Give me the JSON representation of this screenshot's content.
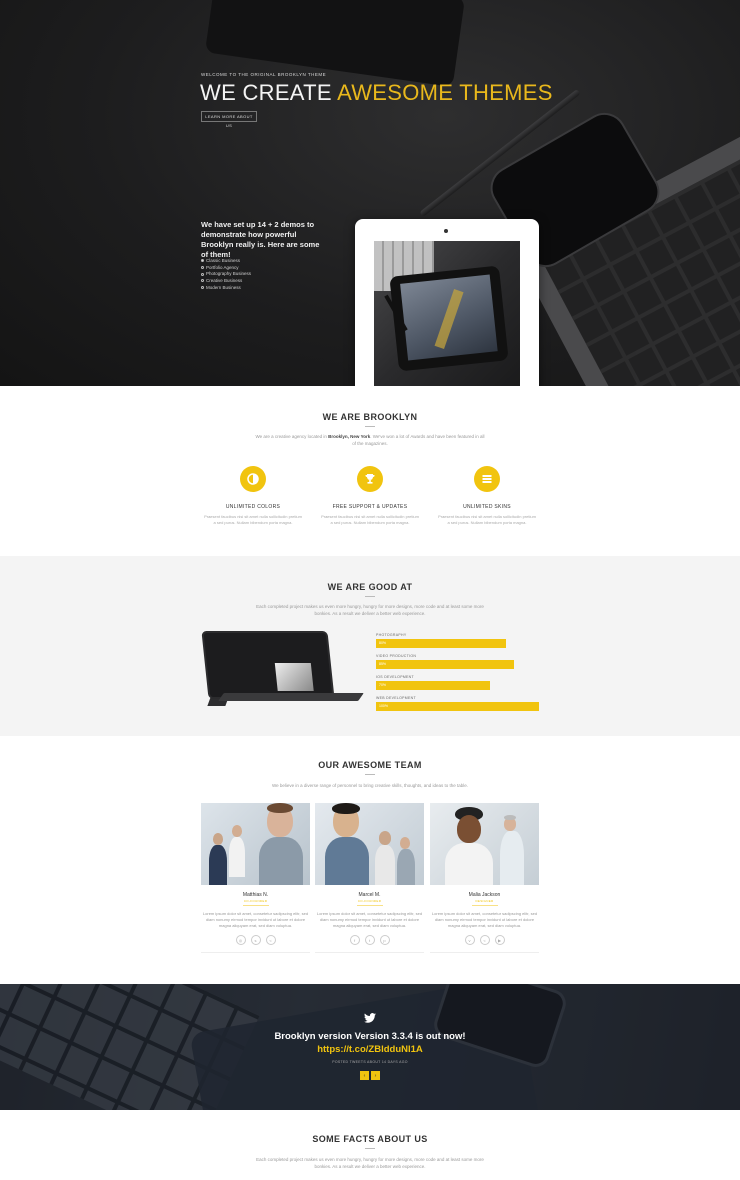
{
  "hero": {
    "eyebrow": "WELCOME TO THE ORIGINAL BROOKLYN THEME",
    "title_white": "WE CREATE ",
    "title_yellow": "AWESOME THEMES",
    "button": "LEARN MORE ABOUT US",
    "sub": "We have set up 14 + 2 demos to demonstrate how powerful Brooklyn really is. Here are some of them!",
    "demos": [
      "Classic Business",
      "Portfolio Agency",
      "Photography Business",
      "Creative Business",
      "Modern Business"
    ]
  },
  "brooklyn": {
    "title": "WE ARE BROOKLYN",
    "desc_prefix": "We are a creative agency located in ",
    "desc_bold": "Brooklyn, New York",
    "desc_suffix": ". We've won a lot of Awards and have been featured in all of the magazines.",
    "features": [
      {
        "icon": "half-circle-icon",
        "title": "UNLIMITED COLORS",
        "text": "Praesent faucibus nisi sit amet nulla sollicitudin pretium a sed purus. Nullam bibendum porta magna."
      },
      {
        "icon": "trophy-icon",
        "title": "FREE SUPPORT & UPDATES",
        "text": "Praesent faucibus nisi sit amet nulla sollicitudin pretium a sed purus. Nullam bibendum porta magna."
      },
      {
        "icon": "layers-icon",
        "title": "UNLIMITED SKINS",
        "text": "Praesent faucibus nisi sit amet nulla sollicitudin pretium a sed purus. Nullam bibendum porta magna."
      }
    ]
  },
  "goodat": {
    "title": "WE ARE GOOD AT",
    "desc": "Each completed project makes us even more hungry, hungry for more designs, more code and at least some more bonkies. As a result we deliver a better web experience.",
    "skills": [
      {
        "name": "PHOTOGRAPHY",
        "value": "80%"
      },
      {
        "name": "VIDEO PRODUCTION",
        "value": "85%"
      },
      {
        "name": "IOS DEVELOPMENT",
        "value": "70%"
      },
      {
        "name": "WEB DEVELOPMENT",
        "value": "100%"
      }
    ]
  },
  "team": {
    "title": "OUR AWESOME TEAM",
    "desc": "We believe in a diverse range of personnel to bring creative skills, thoughts, and ideas to the table.",
    "members": [
      {
        "name": "Matthias N.",
        "role": "CO-FOUNDER",
        "text": "Lorem ipsum dolor sit amet, consetetur sadipscing elitr, sed diam nonumy eirmod tempor invidunt ut labore et dolore magna aliquyam erat, sed diam voluptua."
      },
      {
        "name": "Marcel M.",
        "role": "CO-FOUNDER",
        "text": "Lorem ipsum dolor sit amet, consetetur sadipscing elitr, sed diam nonumy eirmod tempor invidunt ut labore et dolore magna aliquyam erat, sed diam voluptua."
      },
      {
        "name": "Malia Jackson",
        "role": "DESIGNER",
        "text": "Lorem ipsum dolor sit amet, consetetur sadipscing elitr, sed diam nonumy eirmod tempor invidunt ut labore et dolore magna aliquyam erat, sed diam voluptua."
      }
    ]
  },
  "twitter": {
    "text": "Brooklyn version Version 3.3.4 is out now! ",
    "link": "https://t.co/ZBlddu​Nl1A",
    "meta": "POSTED TWEETS ABOUT 14 DAYS AGO",
    "prev": "‹",
    "next": "›"
  },
  "facts": {
    "title": "SOME FACTS ABOUT US",
    "desc": "Each completed project makes us even more hungry, hungry for more designs, more code and at least some more bonkies. As a result we deliver a better web experience."
  },
  "colors": {
    "accent": "#f1c40f",
    "hero_bg": "#1d1d1e",
    "light_bg": "#f4f4f4"
  }
}
